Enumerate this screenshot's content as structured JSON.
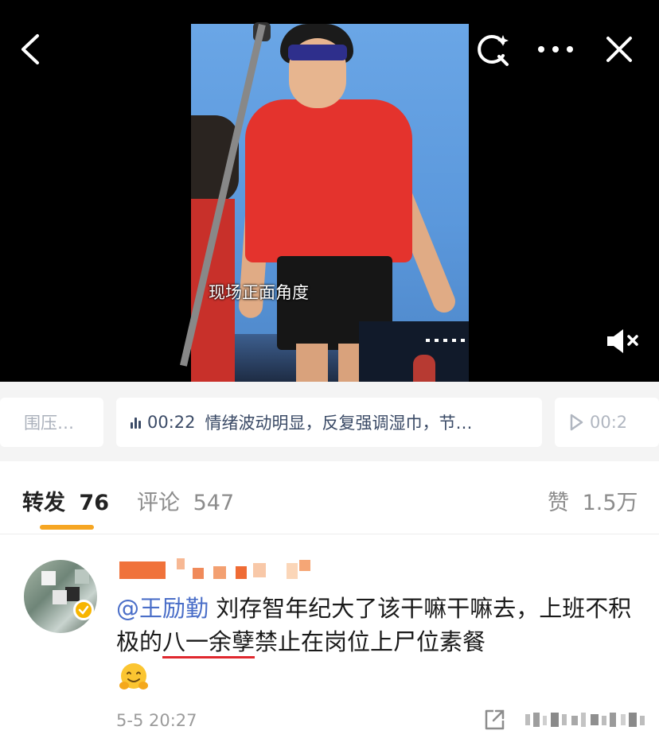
{
  "video": {
    "caption": "现场正面角度",
    "icons": [
      "chevron-left-icon",
      "image-search-icon",
      "more-icon",
      "close-icon",
      "mute-icon"
    ]
  },
  "chapters": {
    "left_chip": "围压…",
    "main_chip": {
      "time": "00:22",
      "text": "情绪波动明显，反复强调湿巾，节…"
    },
    "right_chip": {
      "icon": "play-icon",
      "time": "00:2"
    }
  },
  "stats": {
    "repost_label": "转发",
    "repost_count": "76",
    "comment_label": "评论",
    "comment_count": "547",
    "like_label": "赞",
    "like_count": "1.5万",
    "active_color": "#f6a623"
  },
  "comment": {
    "mention": "@王励勤",
    "text_a": " 刘存智年纪大了该干嘛干嘛去，上班不积极的",
    "text_underlined": "八一余孽",
    "text_b": "禁止在岗位上尸位素餐",
    "emoji": "hugging-face-emoji",
    "timestamp": "5-5 20:27",
    "mention_color": "#4a6ec8",
    "underline_color": "#e0282e"
  }
}
